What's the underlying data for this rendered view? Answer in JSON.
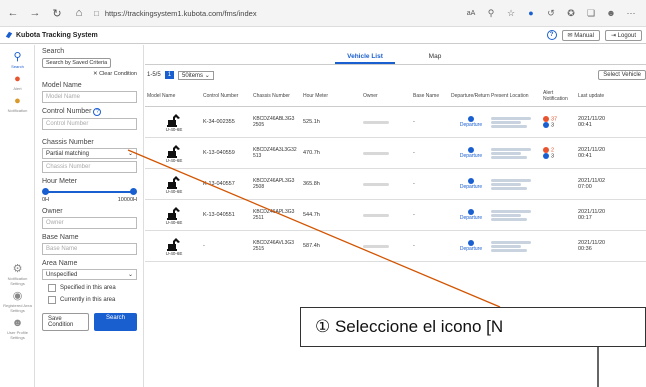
{
  "browser": {
    "url": "https://trackingsystem1.kubota.com/fms/index"
  },
  "app": {
    "title": "Kubota Tracking System",
    "manual_label": "Manual",
    "logout_label": "Logout"
  },
  "rail": [
    {
      "label": "Search",
      "icon": "search-icon"
    },
    {
      "label": "Alert",
      "icon": "alert-icon"
    },
    {
      "label": "Notification",
      "icon": "notification-icon"
    },
    {
      "label": "Notification Settings",
      "icon": "settings-icon"
    },
    {
      "label": "Registered Area Settings",
      "icon": "area-icon"
    },
    {
      "label": "User Profile Settings",
      "icon": "user-icon"
    }
  ],
  "filter": {
    "search_title": "Search",
    "saved_criteria": "Search by Saved Criteria",
    "clear": "Clear Condition",
    "model_name_label": "Model Name",
    "model_name_placeholder": "Model Name",
    "control_number_label": "Control Number",
    "control_number_placeholder": "Control Number",
    "chassis_label": "Chassis Number",
    "chassis_select": "Partial matching",
    "chassis_placeholder": "Chassis Number",
    "hour_meter_label": "Hour Meter",
    "hour_min": "0H",
    "hour_max": "10000H",
    "owner_label": "Owner",
    "owner_placeholder": "Owner",
    "base_name_label": "Base Name",
    "base_name_placeholder": "Base Name",
    "area_name_label": "Area Name",
    "area_select": "Unspecified",
    "specified_label": "Specified in this area",
    "currently_label": "Currently in this area",
    "save_condition": "Save Condition",
    "search_button": "Search"
  },
  "tabs": [
    "Vehicle List",
    "Map"
  ],
  "toolbar": {
    "count": "1-5/5",
    "page": "1",
    "per_page": "50items",
    "select_vehicle": "Select Vehicle"
  },
  "columns": [
    "Model Name",
    "Control Number",
    "Chassis Number",
    "Hour Meter",
    "Owner",
    "Base Name",
    "Departure/Return",
    "Present Location",
    "Alert Notification",
    "Last update"
  ],
  "rows": [
    {
      "model": "U-40-6E",
      "control": "K-34-002355",
      "chassis": "KBCDZ46ABL3G3 2505",
      "hour": "525.1h",
      "base": "-",
      "departure": "Departure",
      "alert_red": "37",
      "alert_blue": "3",
      "date": "2021/11/20",
      "time": "00:41"
    },
    {
      "model": "U-40-6E",
      "control": "K-13-040559",
      "chassis": "KBCDZ46A3L3G32 513",
      "hour": "470.7h",
      "base": "-",
      "departure": "Departure",
      "alert_red": "2",
      "alert_blue": "3",
      "date": "2021/11/20",
      "time": "00:41"
    },
    {
      "model": "U-40-6E",
      "control": "K-13-040557",
      "chassis": "KBCDZ46APL3G3 2508",
      "hour": "365.8h",
      "base": "-",
      "departure": "Departure",
      "alert_red": "",
      "alert_blue": "",
      "date": "2021/11/02",
      "time": "07:00"
    },
    {
      "model": "U-40-6E",
      "control": "K-13-040551",
      "chassis": "KBCDZ46APL3G3 2511",
      "hour": "544.7h",
      "base": "-",
      "departure": "Departure",
      "alert_red": "",
      "alert_blue": "",
      "date": "2021/11/20",
      "time": "00:17"
    },
    {
      "model": "U-40-6E",
      "control": "-",
      "chassis": "KBCDZ46AVL3G3 2515",
      "hour": "587.4h",
      "base": "-",
      "departure": "Departure",
      "alert_red": "",
      "alert_blue": "",
      "date": "2021/11/20",
      "time": "00:36"
    }
  ],
  "callout": "① Seleccione el icono [N"
}
